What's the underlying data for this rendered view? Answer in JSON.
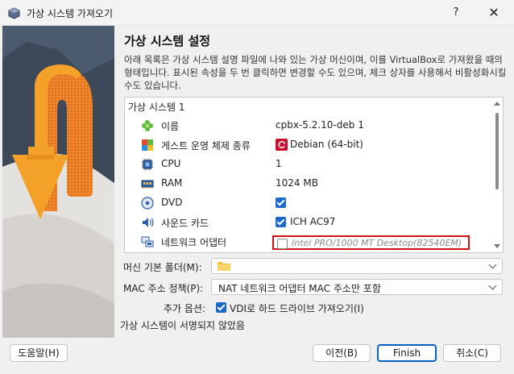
{
  "window": {
    "title": "가상 시스템 가져오기",
    "help_button": "?",
    "close_button": "✕"
  },
  "page": {
    "heading": "가상 시스템 설정",
    "description": "아래 목록은 가상 시스템 설명 파일에 나와 있는 가상 머신이며, 이를 VirtualBox로 가져왔을 때의 형태입니다. 표시된 속성을 두 번 클릭하면 변경할 수도 있으며, 체크 상자를 사용해서 비활성화시킬 수도 있습니다."
  },
  "settings_tree": {
    "group_label": "가상 시스템 1",
    "rows": [
      {
        "label": "이름",
        "value": "cpbx-5.2.10-deb 1",
        "icon": "name-icon"
      },
      {
        "label": "게스트 운영 체제 종류",
        "value": "Debian (64-bit)",
        "icon": "os-type-icon"
      },
      {
        "label": "CPU",
        "value": "1",
        "icon": "cpu-icon"
      },
      {
        "label": "RAM",
        "value": "1024 MB",
        "icon": "ram-icon"
      },
      {
        "label": "DVD",
        "value": "",
        "checked": true,
        "icon": "dvd-icon"
      },
      {
        "label": "사운드 카드",
        "value": "ICH AC97",
        "checked": true,
        "icon": "sound-card-icon"
      },
      {
        "label": "네트워크 어댑터",
        "value": "Intel PRO/1000 MT Desktop(82540EM)",
        "checked": false,
        "icon": "network-adapter-icon"
      }
    ]
  },
  "machine_folder": {
    "label": "머신 기본 폴더(M):",
    "value": ""
  },
  "mac_policy": {
    "label": "MAC 주소 정책(P):",
    "value": "NAT 네트워크 어댑터 MAC 주소만 포함"
  },
  "additional_options": {
    "label": "추가 옵션:",
    "import_vdi_label": "VDI로 하드 드라이브 가져오기(I)",
    "import_vdi_checked": true
  },
  "status_text": "가상 시스템이 서명되지 않았음",
  "buttons": {
    "help": "도움말(H)",
    "back": "이전(B)",
    "finish": "Finish",
    "cancel": "취소(C)"
  },
  "colors": {
    "accent": "#1b6ac9",
    "highlight_border": "#d01010"
  }
}
